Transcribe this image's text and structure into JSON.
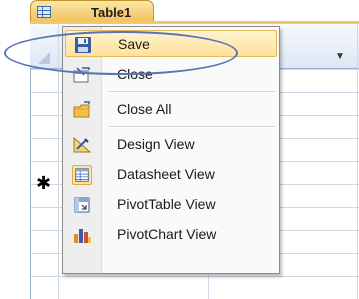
{
  "document_tab": {
    "label": "Table1",
    "icon": "table-icon"
  },
  "header": {
    "dropdown_glyph": "▼"
  },
  "new_record_marker": "✱",
  "menu": {
    "items": [
      {
        "label": "Save",
        "icon": "save-icon",
        "hover": true
      },
      {
        "label": "Close",
        "icon": "close-icon"
      },
      {
        "label": "Close All",
        "icon": "close-all-icon"
      },
      {
        "label": "Design View",
        "icon": "design-view-icon"
      },
      {
        "label": "Datasheet View",
        "icon": "datasheet-view-icon",
        "active": true
      },
      {
        "label": "PivotTable View",
        "icon": "pivottable-view-icon"
      },
      {
        "label": "PivotChart View",
        "icon": "pivotchart-view-icon"
      }
    ]
  },
  "colors": {
    "tab_accent": "#f1c25a",
    "menu_hover": "#ffe19a",
    "highlight_ring": "#5575b4"
  }
}
